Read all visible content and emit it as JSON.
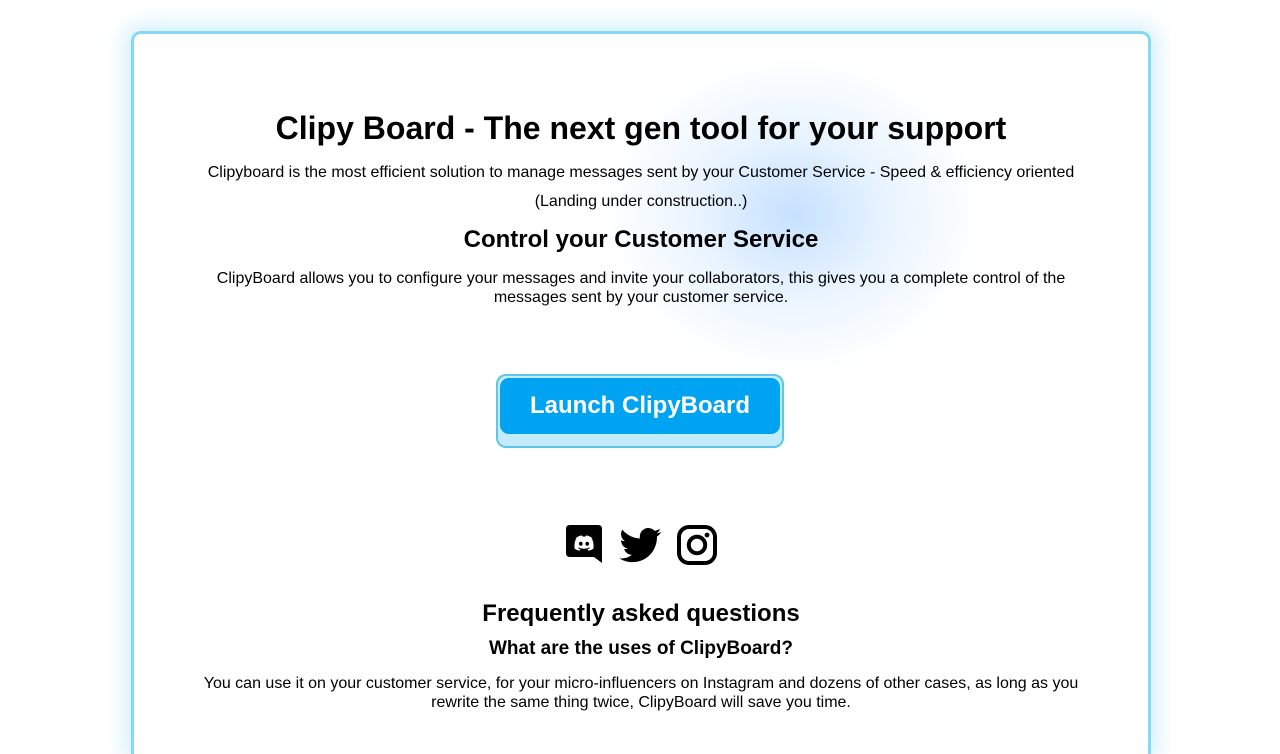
{
  "hero": {
    "title": "Clipy Board - The next gen tool for your support",
    "subtitle": "Clipyboard is the most efficient solution to manage messages sent by your Customer Service - Speed & efficiency oriented",
    "status": "(Landing under construction..)"
  },
  "control": {
    "heading": "Control your Customer Service",
    "text": "ClipyBoard allows you to configure your messages and invite your collaborators, this gives you a complete control of the messages sent by your customer service."
  },
  "cta": {
    "label": "Launch ClipyBoard",
    "color": "#00a2f2"
  },
  "socials": [
    {
      "icon": "discord-icon"
    },
    {
      "icon": "twitter-icon"
    },
    {
      "icon": "instagram-icon"
    }
  ],
  "faq": {
    "title": "Frequently asked questions",
    "question": "What are the uses of ClipyBoard?",
    "answer": "You can use it on your customer service, for your micro-influencers on Instagram and dozens of other cases, as long as you rewrite the same thing twice, ClipyBoard will save you time."
  },
  "colors": {
    "card_border": "#86d8f3",
    "button_shadow": "#c2ecfb"
  }
}
